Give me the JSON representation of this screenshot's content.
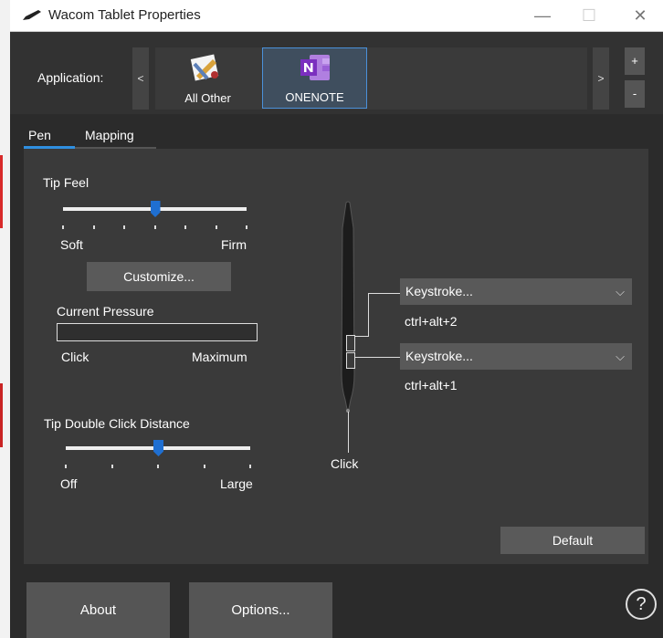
{
  "window": {
    "title": "Wacom Tablet Properties",
    "minimize": "—",
    "maximize": "☐",
    "close": "✕"
  },
  "application_bar": {
    "label": "Application:",
    "scroll_left": "<",
    "scroll_right": ">",
    "add": "+",
    "remove": "-",
    "apps": [
      {
        "label": "All Other",
        "selected": false
      },
      {
        "label": "ONENOTE",
        "selected": true
      }
    ]
  },
  "tabs": [
    {
      "label": "Pen",
      "active": true
    },
    {
      "label": "Mapping",
      "active": false
    }
  ],
  "tip_feel": {
    "title": "Tip Feel",
    "min_label": "Soft",
    "max_label": "Firm",
    "value_fraction": 0.5,
    "tick_count": 7,
    "customize_label": "Customize..."
  },
  "current_pressure": {
    "title": "Current Pressure",
    "min_label": "Click",
    "max_label": "Maximum",
    "level_fraction": 0
  },
  "double_click": {
    "title": "Tip Double Click Distance",
    "min_label": "Off",
    "max_label": "Large",
    "value_fraction": 0.5,
    "tick_count": 5
  },
  "pen_buttons": {
    "upper": {
      "function": "Keystroke...",
      "shortcut": "ctrl+alt+2"
    },
    "lower": {
      "function": "Keystroke...",
      "shortcut": "ctrl+alt+1"
    },
    "tip_label": "Click"
  },
  "default_label": "Default",
  "footer": {
    "about_label": "About",
    "options_label": "Options...",
    "help_label": "?"
  },
  "colors": {
    "accent": "#1f6fd1",
    "selection_border": "#4a90d9",
    "onenote": "#7b2fbf"
  }
}
